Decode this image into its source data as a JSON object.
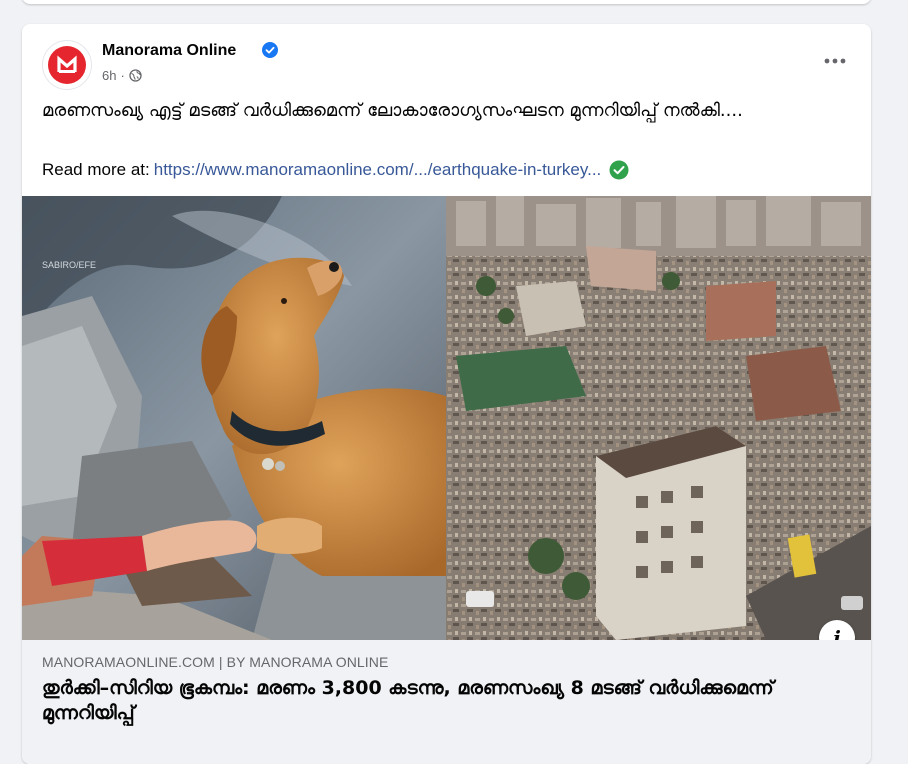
{
  "post": {
    "page_name": "Manorama Online",
    "time": "6h",
    "meta_separator": "·",
    "text": "മരണസംഖ്യ എട്ട് മടങ്ങ് വർധിക്കുമെന്ന് ലോകാരോഗ്യസംഘടന മുന്നറിയിപ്പ് നൽകി....",
    "read_more_prefix": "Read more at:",
    "read_more_link": "https://www.manoramaonline.com/.../earthquake-in-turkey...",
    "watermark": "SABIRO/EFE"
  },
  "link_preview": {
    "domain": "MANORAMAONLINE.COM | BY MANORAMA ONLINE",
    "headline": "തുർക്കി–സിറിയ ഭൂകമ്പം: മരണം 3,800 കടന്നു, മരണസംഖ്യ 8 മടങ്ങ് വർധിക്കുമെന്ന് മുന്നറിയിപ്പ്"
  },
  "icons": {
    "avatar": "manorama-logo-icon",
    "verified": "verified-badge-icon",
    "audience": "globe-icon",
    "more": "more-horizontal-icon",
    "link_check": "green-check-icon",
    "info": "info-icon"
  },
  "colors": {
    "brand_red": "#e5262e",
    "link_blue": "#385898",
    "verified_blue": "#1877f2",
    "check_green": "#31a24c"
  },
  "info_label": "i"
}
